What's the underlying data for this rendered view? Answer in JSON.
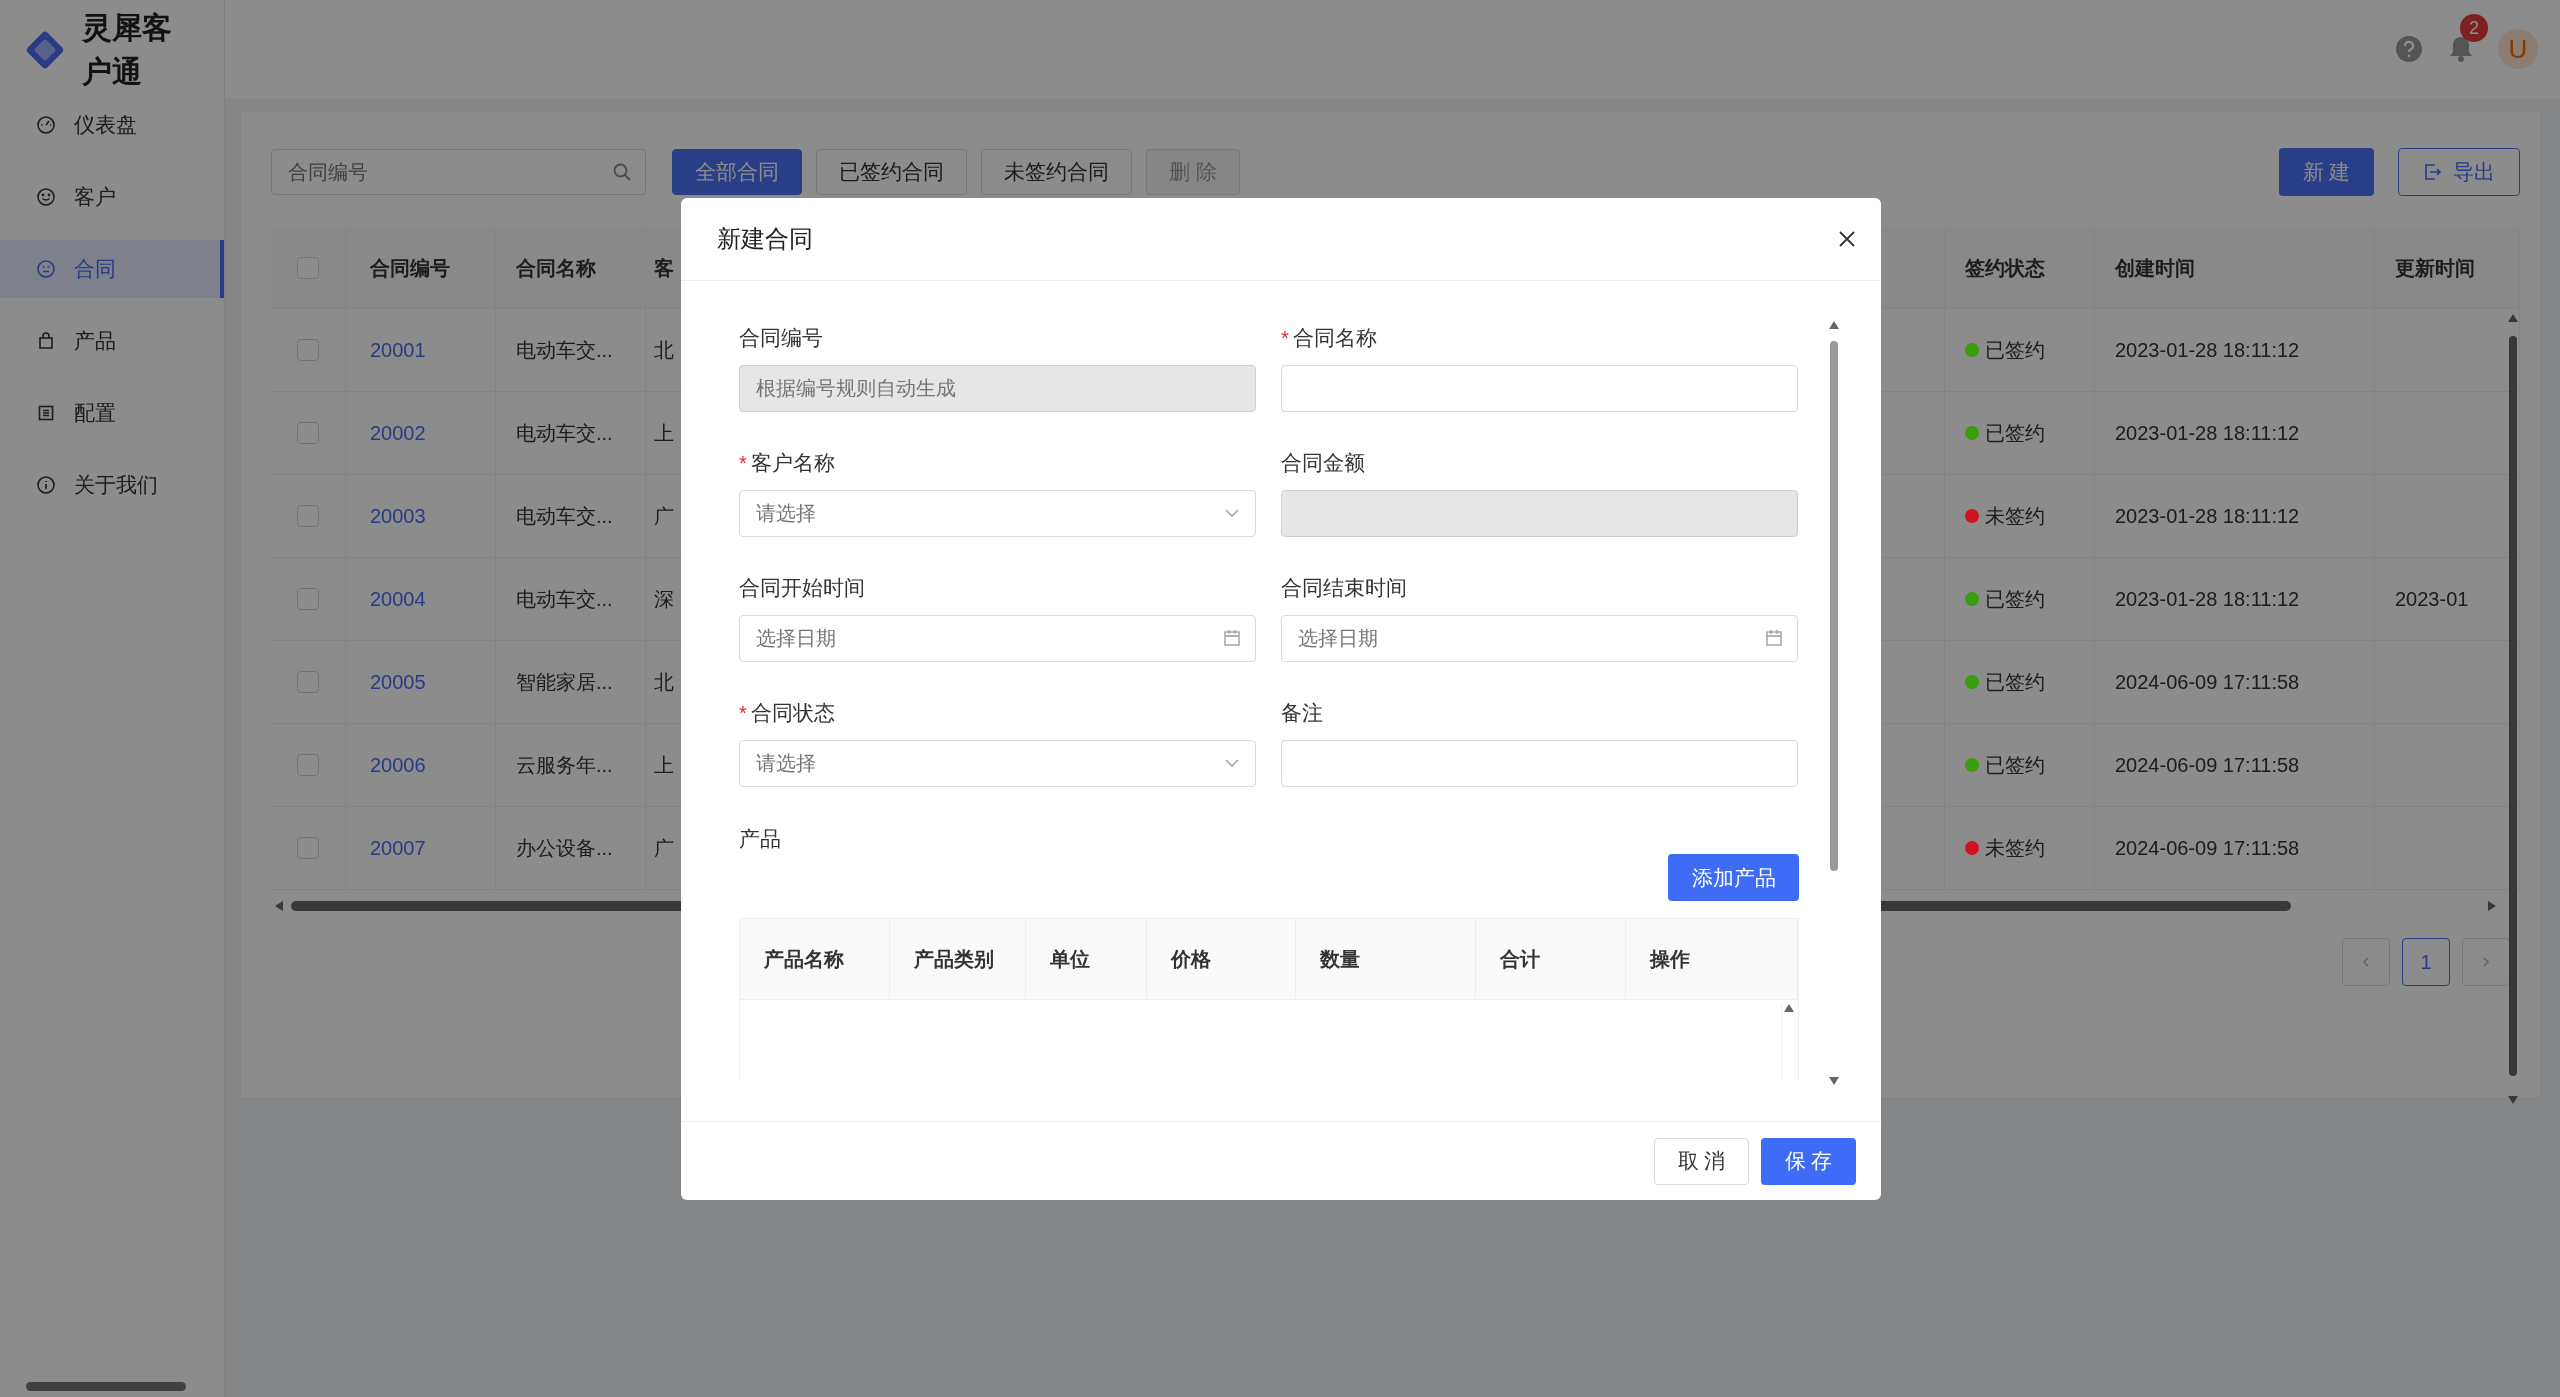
{
  "app": {
    "name": "灵犀客户通"
  },
  "sidebar": {
    "items": [
      {
        "label": "仪表盘",
        "selected": false
      },
      {
        "label": "客户",
        "selected": false
      },
      {
        "label": "合同",
        "selected": true
      },
      {
        "label": "产品",
        "selected": false
      },
      {
        "label": "配置",
        "selected": false
      },
      {
        "label": "关于我们",
        "selected": false
      }
    ]
  },
  "header": {
    "notification_count": "2",
    "avatar": "U"
  },
  "toolbar": {
    "search": {
      "placeholder": "合同编号"
    },
    "filters": [
      {
        "label": "全部合同",
        "selected": true
      },
      {
        "label": "已签约合同",
        "selected": false
      },
      {
        "label": "未签约合同",
        "selected": false
      }
    ],
    "delete_button": {
      "label": "删 除",
      "disabled": true
    },
    "new_button": "新 建",
    "export_button": "导出"
  },
  "table": {
    "all_checked": false,
    "columns": [
      "合同编号",
      "合同名称",
      "客",
      "签约状态",
      "创建时间",
      "更新时间"
    ],
    "rows": [
      {
        "checked": false,
        "number": "20001",
        "name": "电动车交...",
        "column_3": "北",
        "status": "已签约",
        "color": "#389e0d",
        "created": "2023-01-28 18:11:12"
      },
      {
        "checked": false,
        "number": "20002",
        "name": "电动车交...",
        "column_3": "上",
        "status": "已签约",
        "color": "#389e0d",
        "created": "2023-01-28 18:11:12"
      },
      {
        "checked": false,
        "number": "20003",
        "name": "电动车交...",
        "column_3": "广",
        "status": "未签约",
        "color": "#cf1322",
        "created": "2023-01-28 18:11:12"
      },
      {
        "checked": false,
        "number": "20004",
        "name": "电动车交...",
        "column_3": "深",
        "status": "已签约",
        "color": "#389e0d",
        "created": "2023-01-28 18:11:12",
        "updated": "2023-01"
      },
      {
        "checked": false,
        "number": "20005",
        "name": "智能家居...",
        "column_3": "北",
        "status": "已签约",
        "color": "#389e0d",
        "created": "2024-06-09 17:11:58"
      },
      {
        "checked": false,
        "number": "20006",
        "name": "云服务年...",
        "column_3": "上",
        "status": "已签约",
        "color": "#389e0d",
        "created": "2024-06-09 17:11:58"
      },
      {
        "checked": false,
        "number": "20007",
        "name": "办公设备...",
        "column_3": "广",
        "status": "未签约",
        "color": "#cf1322",
        "created": "2024-06-09 17:11:58"
      }
    ]
  },
  "pagination": {
    "pages": [
      {
        "label": "1",
        "selected": true
      }
    ]
  },
  "dialog": {
    "title": "新建合同",
    "fields": [
      {
        "label": "合同编号",
        "kind": "text",
        "placeholder": "根据编号规则自动生成",
        "disabled": true
      },
      {
        "label": "合同名称",
        "required_mark": "*",
        "kind": "text",
        "disabled": false
      },
      {
        "label": "客户名称",
        "required_mark": "*",
        "kind": "select",
        "placeholder": "请选择",
        "disabled": false
      },
      {
        "label": "合同金额",
        "kind": "text",
        "disabled": true
      },
      {
        "label": "合同开始时间",
        "kind": "date",
        "placeholder": "选择日期",
        "disabled": false
      },
      {
        "label": "合同结束时间",
        "kind": "date",
        "placeholder": "选择日期",
        "disabled": false
      },
      {
        "label": "合同状态",
        "required_mark": "*",
        "kind": "select",
        "placeholder": "请选择",
        "disabled": false
      },
      {
        "label": "备注",
        "kind": "text",
        "disabled": false
      }
    ],
    "products": {
      "label": "产品",
      "add_button": "添加产品",
      "columns": [
        "产品名称",
        "产品类别",
        "单位",
        "价格",
        "数量",
        "合计",
        "操作"
      ]
    },
    "cancel_button": "取 消",
    "save_button": "保 存"
  }
}
